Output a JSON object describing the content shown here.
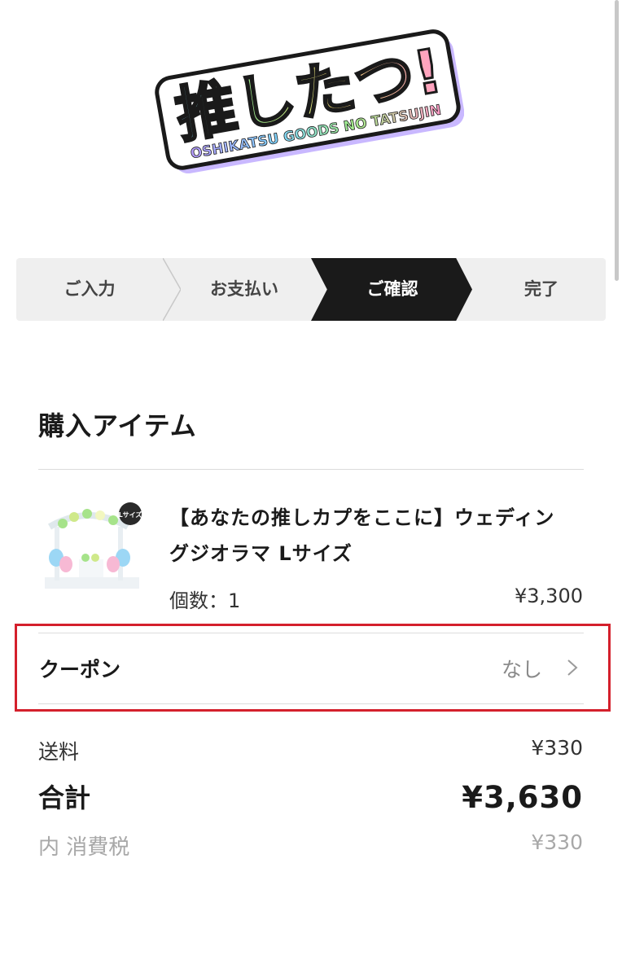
{
  "logo": {
    "main_text": "推したつ!",
    "sub_text": "OSHIKATSU GOODS NO TATSUJIN",
    "colors": [
      "#ff9bc8",
      "#ffe27a",
      "#a6f08c",
      "#7fd6ff",
      "#b89cff"
    ]
  },
  "steps": [
    {
      "label": "ご入力",
      "active": false
    },
    {
      "label": "お支払い",
      "active": false
    },
    {
      "label": "ご確認",
      "active": true
    },
    {
      "label": "完了",
      "active": false
    }
  ],
  "purchase": {
    "section_title": "購入アイテム",
    "item": {
      "name": "【あなたの推しカプをここに】ウェディングジオラマ Lサイズ",
      "thumb_badge": "Lサイズ",
      "quantity_label": "個数：1",
      "price": "¥3,300"
    }
  },
  "coupon": {
    "label": "クーポン",
    "value": "なし",
    "highlight_color": "#d4202c"
  },
  "summary": {
    "shipping_label": "送料",
    "shipping_value": "¥330",
    "total_label": "合計",
    "total_value": "¥3,630",
    "tax_label": "内 消費税",
    "tax_value": "¥330"
  },
  "colors": {
    "accent_dark": "#1a1a1a",
    "steps_bg": "#efefef"
  }
}
